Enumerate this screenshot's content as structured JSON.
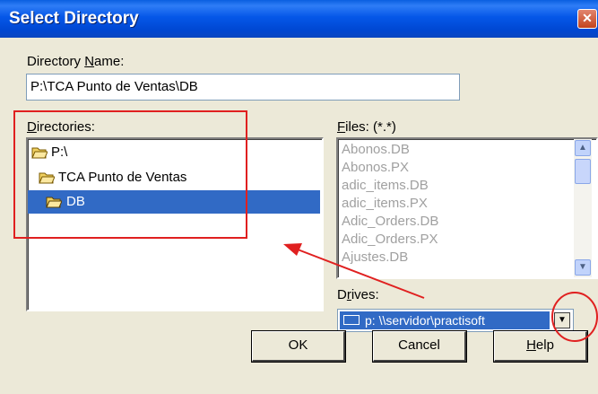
{
  "window": {
    "title": "Select Directory"
  },
  "directory_name": {
    "label": "Directory Name:",
    "value": "P:\\TCA Punto de Ventas\\DB"
  },
  "directories": {
    "label": "Directories:",
    "items": [
      "P:\\",
      "TCA Punto de Ventas",
      "DB"
    ],
    "selected": "DB"
  },
  "files": {
    "label": "Files: (*.*)",
    "items": [
      "Abonos.DB",
      "Abonos.PX",
      "adic_items.DB",
      "adic_items.PX",
      "Adic_Orders.DB",
      "Adic_Orders.PX",
      "Ajustes.DB"
    ]
  },
  "drives": {
    "label": "Drives:",
    "value": "p: \\\\servidor\\practisoft"
  },
  "buttons": {
    "ok": "OK",
    "cancel": "Cancel",
    "help": "Help"
  },
  "colors": {
    "annotation": "#e02020",
    "selection": "#316ac5",
    "titlebar": "#0557e8"
  }
}
